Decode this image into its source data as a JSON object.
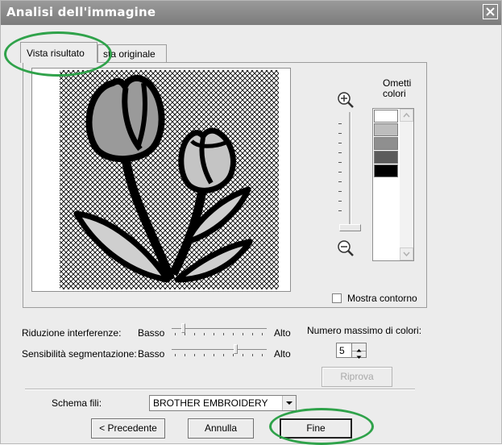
{
  "window": {
    "title": "Analisi dell'immagine"
  },
  "tabs": [
    {
      "label": "Vista risultato",
      "active": true
    },
    {
      "label": "sta originale",
      "active": false
    }
  ],
  "omit_colors": {
    "label": "Ometti colori",
    "swatches": [
      "#ffffff",
      "#bdbdbd",
      "#8f8f8f",
      "#5c5c5c",
      "#000000",
      "#ffffff"
    ]
  },
  "show_outline": {
    "label": "Mostra contorno",
    "checked": false
  },
  "noise_reduction": {
    "label": "Riduzione interferenze:",
    "low": "Basso",
    "high": "Alto",
    "level": 0.1
  },
  "segmentation": {
    "label": "Sensibilità segmentazione:",
    "low": "Basso",
    "high": "Alto",
    "level": 0.7
  },
  "max_colors": {
    "label": "Numero massimo di colori:",
    "value": "5"
  },
  "buttons": {
    "retry": "Riprova",
    "previous": "< Precedente",
    "cancel": "Annulla",
    "finish": "Fine"
  },
  "thread_scheme": {
    "label": "Schema fili:",
    "value": "BROTHER EMBROIDERY"
  },
  "colors": {
    "titlebar": "#8a8a8a",
    "highlight": "#2fa24a",
    "dialog": "#ececec"
  }
}
